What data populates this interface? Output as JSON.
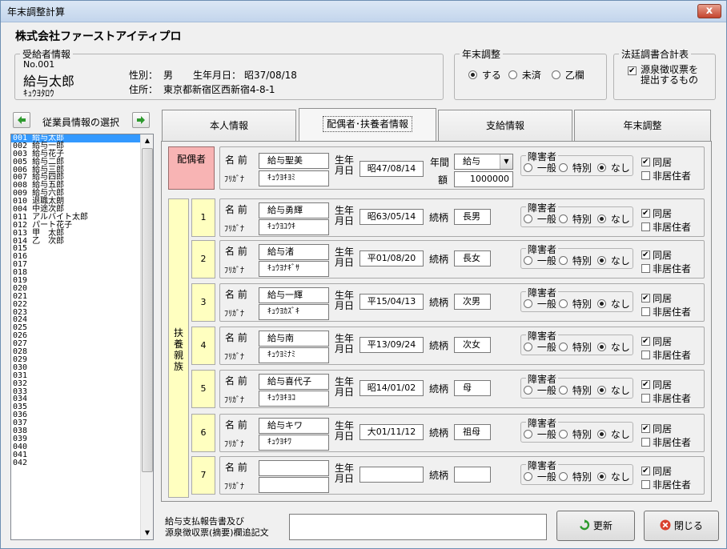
{
  "window": {
    "title": "年末調整計算",
    "close_label": "x"
  },
  "company": "株式会社ファーストアイティプロ",
  "employee_info": {
    "legend": "受給者情報",
    "no": "No.001",
    "name": "給与太郎",
    "kana": "ｷｭｳﾖﾀﾛｳ",
    "gender_label": "性別：",
    "gender": "男",
    "birth_label": "生年月日：",
    "birth": "昭37/08/18",
    "address_label": "住所：",
    "address": "東京都新宿区西新宿4-8-1"
  },
  "year_end": {
    "legend": "年末調整",
    "options": [
      "する",
      "未済",
      "乙欄"
    ],
    "selected": 0
  },
  "legal": {
    "legend": "法廷調書合計表",
    "checkbox_label_1": "源泉徴収票を",
    "checkbox_label_2": "提出するもの",
    "checked": true
  },
  "employee_select": {
    "label": "従業員情報の選択",
    "prev": "◆",
    "next": "◆"
  },
  "employee_list": [
    "001 給与太郎",
    "002 給与一郎",
    "003 給与花子",
    "005 給与二郎",
    "006 給与三郎",
    "007 給与四郎",
    "008 給与五郎",
    "009 給与六郎",
    "010 退職太朗",
    "004 中途次郎",
    "011 アルバイト太郎",
    "012 パート花子",
    "013 甲　太郎",
    "014 乙　次郎",
    "015",
    "016",
    "017",
    "018",
    "019",
    "020",
    "021",
    "022",
    "023",
    "024",
    "025",
    "026",
    "027",
    "028",
    "029",
    "030",
    "031",
    "032",
    "033",
    "034",
    "035",
    "036",
    "037",
    "038",
    "039",
    "040",
    "041",
    "042"
  ],
  "tabs": [
    "本人情報",
    "配偶者･扶養者情報",
    "支給情報",
    "年末調整"
  ],
  "active_tab": 1,
  "labels": {
    "spouse_block": "配偶者",
    "dependents_block": "扶養親族",
    "name": "名 前",
    "kana": "ﾌﾘｶﾞﾅ",
    "birth_1": "生年",
    "birth_2": "月日",
    "relation": "続柄",
    "annual_1": "年間",
    "annual_2": "額",
    "disability": "障害者",
    "dis_options": [
      "一般",
      "特別",
      "なし"
    ],
    "cohabit": "同居",
    "nonresident": "非居住者"
  },
  "spouse": {
    "name": "給与聖美",
    "kana": "ｷｭｳﾖｷﾖﾐ",
    "birth": "昭47/08/14",
    "income_type": "給与",
    "income_amount": "1000000",
    "disability": 2,
    "cohabit": true,
    "nonresident": false
  },
  "dependents": [
    {
      "no": "1",
      "name": "給与勇輝",
      "kana": "ｷｭｳﾖﾕｳｷ",
      "birth": "昭63/05/14",
      "relation": "長男",
      "disability": 2,
      "cohabit": true,
      "nonresident": false
    },
    {
      "no": "2",
      "name": "給与渚",
      "kana": "ｷｭｳﾖﾅｷﾞｻ",
      "birth": "平01/08/20",
      "relation": "長女",
      "disability": 2,
      "cohabit": true,
      "nonresident": false
    },
    {
      "no": "3",
      "name": "給与一輝",
      "kana": "ｷｭｳﾖｶｽﾞｷ",
      "birth": "平15/04/13",
      "relation": "次男",
      "disability": 2,
      "cohabit": true,
      "nonresident": false
    },
    {
      "no": "4",
      "name": "給与南",
      "kana": "ｷｭｳﾖﾐﾅﾐ",
      "birth": "平13/09/24",
      "relation": "次女",
      "disability": 2,
      "cohabit": true,
      "nonresident": false
    },
    {
      "no": "5",
      "name": "給与喜代子",
      "kana": "ｷｭｳﾖｷﾖｺ",
      "birth": "昭14/01/02",
      "relation": "母",
      "disability": 2,
      "cohabit": true,
      "nonresident": false
    },
    {
      "no": "6",
      "name": "給与キワ",
      "kana": "ｷｭｳﾖｷﾜ",
      "birth": "大01/11/12",
      "relation": "祖母",
      "disability": 2,
      "cohabit": true,
      "nonresident": false
    },
    {
      "no": "7",
      "name": "",
      "kana": "",
      "birth": "",
      "relation": "",
      "disability": 2,
      "cohabit": true,
      "nonresident": false
    }
  ],
  "footer": {
    "note_label_1": "給与支払報告書及び",
    "note_label_2": "源泉徴収票(摘要)欄追記文",
    "note_value": "",
    "update_button": "更新",
    "close_button": "閉じる"
  },
  "colors": {
    "spouse_bg": "#f8b4b4",
    "dependent_bg": "#ffffc0",
    "selection": "#3399ff"
  }
}
